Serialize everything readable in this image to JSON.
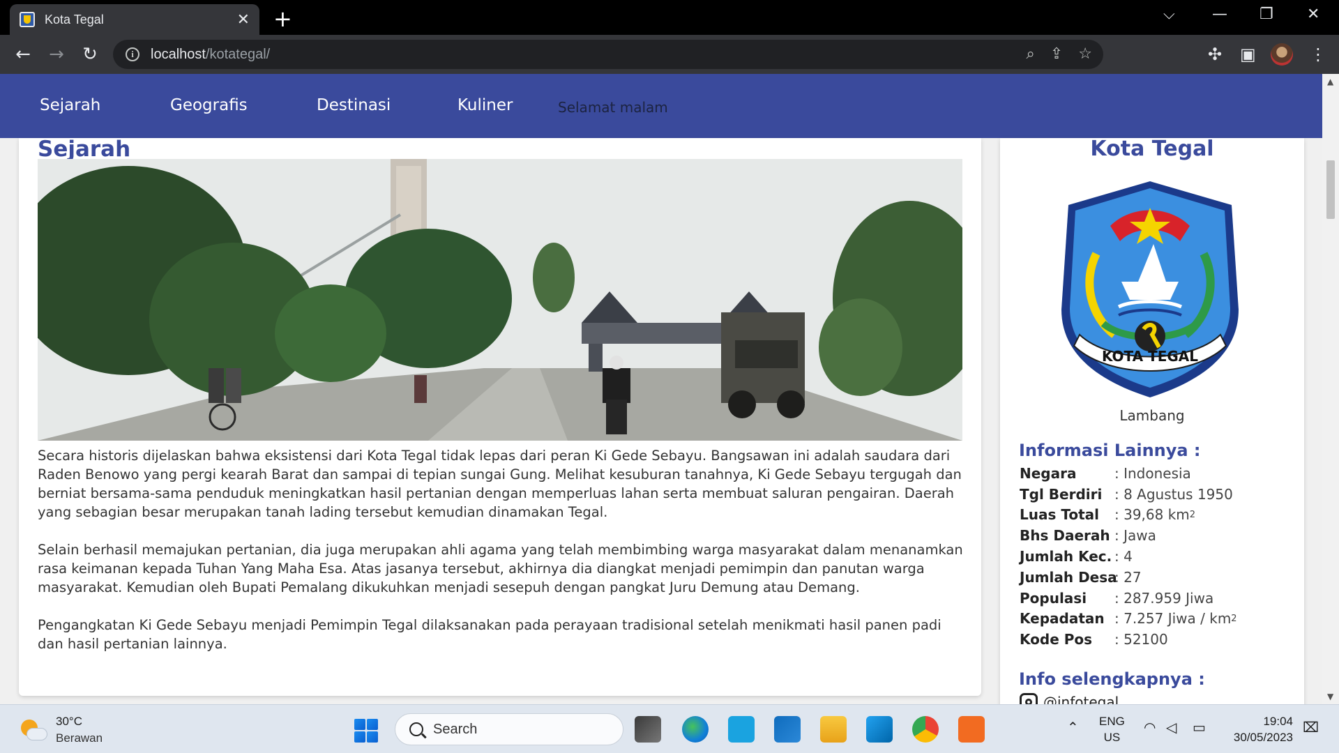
{
  "browser": {
    "tab_title": "Kota Tegal",
    "tab_close": "✕",
    "new_tab": "+",
    "url_host": "localhost",
    "url_path": "/kotategal/"
  },
  "nav": {
    "items": [
      "Sejarah",
      "Geografis",
      "Destinasi",
      "Kuliner"
    ],
    "greeting": "Selamat malam"
  },
  "main": {
    "title": "Sejarah",
    "paragraphs": [
      "Secara historis dijelaskan bahwa eksistensi dari Kota Tegal tidak lepas dari peran Ki Gede Sebayu. Bangsawan ini adalah saudara dari Raden Benowo yang pergi kearah Barat dan sampai di tepian sungai Gung. Melihat kesuburan tanahnya, Ki Gede Sebayu tergugah dan berniat bersama-sama penduduk meningkatkan hasil pertanian dengan memperluas lahan serta membuat saluran pengairan. Daerah yang sebagian besar merupakan tanah lading tersebut kemudian dinamakan Tegal.",
      "Selain berhasil memajukan pertanian, dia juga merupakan ahli agama yang telah membimbing warga masyarakat dalam menanamkan rasa keimanan kepada Tuhan Yang Maha Esa. Atas jasanya tersebut, akhirnya dia diangkat menjadi pemimpin dan panutan warga masyarakat. Kemudian oleh Bupati Pemalang dikukuhkan menjadi sesepuh dengan pangkat Juru Demung atau Demang.",
      "Pengangkatan Ki Gede Sebayu menjadi Pemimpin Tegal dilaksanakan pada perayaan tradisional setelah menikmati hasil panen padi dan hasil pertanian lainnya."
    ]
  },
  "sidebar": {
    "title": "Kota Tegal",
    "emblem_caption": "Lambang",
    "emblem_text": "KOTA TEGAL",
    "info_heading": "Informasi Lainnya :",
    "info": [
      {
        "key": "Negara",
        "value": ": Indonesia"
      },
      {
        "key": "Tgl Berdiri",
        "value": ": 8 Agustus 1950"
      },
      {
        "key": "Luas Total",
        "value": ": 39,68 km",
        "sup": "2"
      },
      {
        "key": "Bhs Daerah",
        "value": ": Jawa"
      },
      {
        "key": "Jumlah Kec.",
        "value": ": 4"
      },
      {
        "key": "Jumlah Desa",
        "value": ": 27"
      },
      {
        "key": "Populasi",
        "value": ": 287.959 Jiwa"
      },
      {
        "key": "Kepadatan",
        "value": ": 7.257 Jiwa / km",
        "sup": "2"
      },
      {
        "key": "Kode Pos",
        "value": ": 52100"
      }
    ],
    "more_heading": "Info selengkapnya :",
    "more_handle": "@infotegal"
  },
  "taskbar": {
    "temperature": "30°C",
    "weather": "Berawan",
    "search_label": "Search",
    "lang_top": "ENG",
    "lang_bottom": "US",
    "time": "19:04",
    "date": "30/05/2023"
  },
  "colors": {
    "nav_bg": "#3a4a9c",
    "accent": "#3a4a9c"
  }
}
